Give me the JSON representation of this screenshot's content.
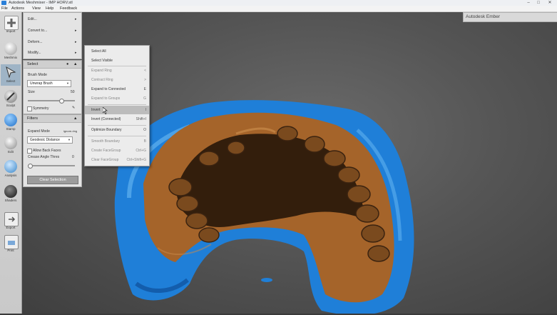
{
  "window": {
    "title": "Autodesk Meshmixer - IMP HORV.stl",
    "minimize": "–",
    "maximize": "□",
    "close": "✕"
  },
  "menu": [
    "File",
    "Actions",
    "View",
    "Help",
    "Feedback"
  ],
  "toolbar": [
    {
      "label": "Import",
      "icon": "plus-icon"
    },
    {
      "label": "Meshmix",
      "icon": "meshmix-icon"
    },
    {
      "label": "Select",
      "icon": "select-arrow-icon"
    },
    {
      "label": "Sculpt",
      "icon": "sculpt-brush-icon"
    },
    {
      "label": "Stamp",
      "icon": "stamp-icon"
    },
    {
      "label": "Edit",
      "icon": "edit-sphere-icon"
    },
    {
      "label": "Analysis",
      "icon": "analysis-icon"
    },
    {
      "label": "Shaders",
      "icon": "shaders-icon"
    },
    {
      "label": "Export",
      "icon": "export-icon"
    },
    {
      "label": "Print",
      "icon": "print-icon"
    }
  ],
  "topmenu": {
    "items": [
      "Edit...",
      "Convert to...",
      "Deform...",
      "Modify..."
    ],
    "arrow": "▸"
  },
  "select_panel": {
    "title": "Select",
    "brush_mode_label": "Brush Mode",
    "brush_mode_value": "Unwrap Brush",
    "size_label": "Size",
    "size_value": "50",
    "symmetry_label": "Symmetry"
  },
  "filters_panel": {
    "title": "Filters",
    "expand_mode_label": "Expand Mode",
    "expand_mode_hint": "ignore-ring",
    "expand_mode_value": "Geodesic Distance",
    "allow_back_faces_label": "Allow Back Faces",
    "crease_angle_label": "Crease Angle Thres",
    "crease_angle_value": "0",
    "clear_selection": "Clear Selection"
  },
  "context_menu": [
    {
      "label": "Select All",
      "shortcut": "",
      "state": "normal"
    },
    {
      "label": "Select Visible",
      "shortcut": "",
      "state": "normal"
    },
    {
      "label": "Expand Ring",
      "shortcut": "<",
      "state": "dim"
    },
    {
      "label": "Contract Ring",
      "shortcut": ">",
      "state": "dim"
    },
    {
      "label": "Expand to Connected",
      "shortcut": "E",
      "state": "normal"
    },
    {
      "label": "Expand to Groups",
      "shortcut": "G",
      "state": "dim"
    },
    {
      "label": "Invert",
      "shortcut": "I",
      "state": "highlight"
    },
    {
      "label": "Invert (Connected)",
      "shortcut": "Shift+I",
      "state": "normal"
    },
    {
      "label": "Optimize Boundary",
      "shortcut": "O",
      "state": "normal"
    },
    {
      "label": "Smooth Boundary",
      "shortcut": "B",
      "state": "dim"
    },
    {
      "label": "Create FaceGroup",
      "shortcut": "Ctrl+G",
      "state": "dim"
    },
    {
      "label": "Clear FaceGroup",
      "shortcut": "Ctrl+Shift+G",
      "state": "dim"
    }
  ],
  "brand": "Autodesk Ember",
  "colors": {
    "mesh_blue": "#1f7fd8",
    "mesh_bronze": "#a5642a",
    "background": "#5a5a5a",
    "panel": "#e4e4e4"
  }
}
